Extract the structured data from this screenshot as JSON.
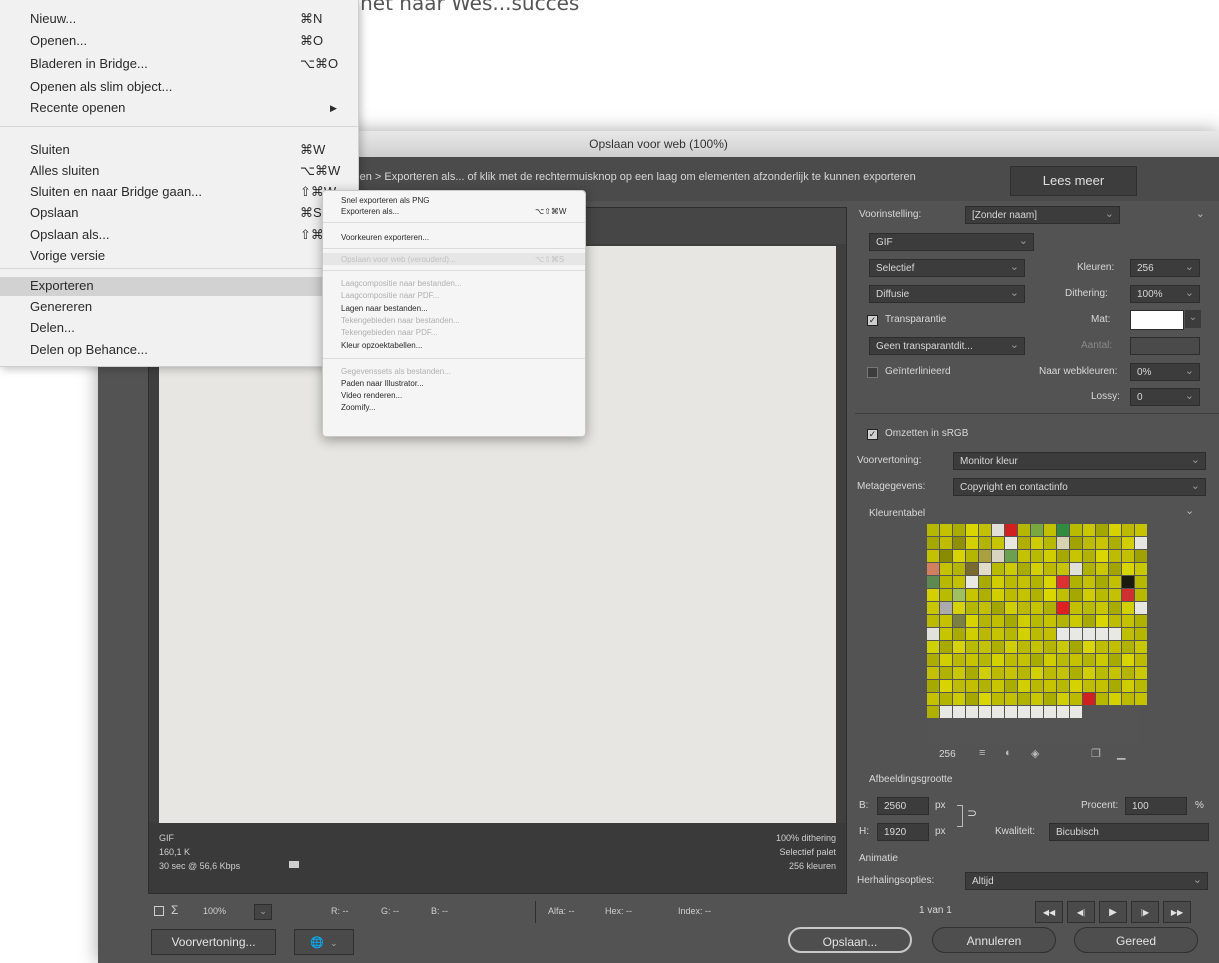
{
  "caption": "c) Sla je project open op en deel het naar Wes...succes",
  "dialog": {
    "title": "Opslaan voor web (100%)",
    "info_text": "tieen > Exporteren als... of klik met de rechtermuisknop op een laag om elementen afzonderlijk te kunnen exporteren",
    "lees_meer": "Lees meer"
  },
  "preview": {
    "format": "GIF",
    "size": "160,1 K",
    "time": "30 sec @ 56,6 Kbps",
    "dither": "100% dithering",
    "palette": "Selectief palet",
    "colors": "256 kleuren",
    "zoom": "100%",
    "r": "R: --",
    "g": "G: --",
    "b": "B: --",
    "alpha": "Alfa: --",
    "hex": "Hex: --",
    "index": "Index: --"
  },
  "panel": {
    "preset_label": "Voorinstelling:",
    "preset_value": "[Zonder naam]",
    "format_value": "GIF",
    "palette_value": "Selectief",
    "colors_label": "Kleuren:",
    "colors_value": "256",
    "dither_value": "Diffusie",
    "dither_label": "Dithering:",
    "dither_pct": "100%",
    "transparency_label": "Transparantie",
    "matte_label": "Mat:",
    "trans_dither_value": "Geen transparantdit...",
    "amount_label": "Aantal:",
    "interlaced_label": "Geïnterlinieerd",
    "web_snap_label": "Naar webkleuren:",
    "web_snap_value": "0%",
    "lossy_label": "Lossy:",
    "lossy_value": "0",
    "convert_srgb_label": "Omzetten in sRGB",
    "preview_label": "Voorvertoning:",
    "preview_value": "Monitor kleur",
    "metadata_label": "Metagegevens:",
    "metadata_value": "Copyright en contactinfo",
    "color_table_label": "Kleurentabel",
    "color_count": "256",
    "image_size_label": "Afbeeldingsgrootte",
    "w_label": "B:",
    "w_value": "2560",
    "h_label": "H:",
    "h_value": "1920",
    "px_label": "px",
    "percent_label": "Procent:",
    "percent_value": "100",
    "pct_sign": "%",
    "quality_label": "Kwaliteit:",
    "quality_value": "Bicubisch",
    "animation_label": "Animatie",
    "loop_label": "Herhalingsopties:",
    "loop_value": "Altijd",
    "frame_counter": "1 van 1",
    "swatches": [
      "#b5b800",
      "#c4c100",
      "#a9ad00",
      "#d9d500",
      "#c2c000",
      "#e0e0d8",
      "#d02020",
      "#b6b800",
      "#7aa840",
      "#c3c000",
      "#328c40",
      "#b8bb00",
      "#c9c700",
      "#a4a700",
      "#d5d200",
      "#bbb900",
      "#c6c400",
      "#a5a800",
      "#c0bd00",
      "#8e9000",
      "#d4d000",
      "#b2b400",
      "#c7c500",
      "#e8e8e0",
      "#b0ae00",
      "#cfcc00",
      "#b7b900",
      "#d7d3b0",
      "#a0a300",
      "#bdbb00",
      "#c8c500",
      "#acae00",
      "#d1ce00",
      "#e6e6e0",
      "#c4c100",
      "#8a8c00",
      "#d6d300",
      "#b4b600",
      "#a9a040",
      "#d8d4c0",
      "#6aa050",
      "#c4c200",
      "#b9bb00",
      "#d0cd00",
      "#a6a900",
      "#c7c500",
      "#b1b300",
      "#d9d600",
      "#bebc00",
      "#c2c000",
      "#9fa200",
      "#d08060",
      "#c5c300",
      "#b3b500",
      "#7b6a30",
      "#e0dcc8",
      "#b8ba00",
      "#cccb00",
      "#a8ab00",
      "#d3d000",
      "#bcba00",
      "#c6c400",
      "#e0e0d8",
      "#b0b200",
      "#c9c700",
      "#a2a500",
      "#d7d400",
      "#c8c800",
      "#5c8a50",
      "#b7b900",
      "#c3c100",
      "#e9e9e4",
      "#a9ac00",
      "#d0cd00",
      "#babb00",
      "#c4c200",
      "#b2b400",
      "#d8d500",
      "#dd3030",
      "#b0b200",
      "#c4c200",
      "#a7aa00",
      "#c2c000",
      "#1a1a10",
      "#b6b800",
      "#d4d000",
      "#b9bb00",
      "#a0c060",
      "#c7c500",
      "#aeb000",
      "#d2cf00",
      "#bdbb00",
      "#c5c300",
      "#b1b300",
      "#d9d600",
      "#c0be00",
      "#a5a800",
      "#cfcc00",
      "#b8ba00",
      "#c3c100",
      "#d03030",
      "#b7b900",
      "#c8c600",
      "#ababab",
      "#d5d200",
      "#b4b600",
      "#c1bf00",
      "#a3a600",
      "#d0cd00",
      "#bcba00",
      "#c6c400",
      "#afb100",
      "#e02020",
      "#c2c000",
      "#b9bb00",
      "#c9c700",
      "#a8ab00",
      "#d3d000",
      "#e8e8e0",
      "#bbb900",
      "#c4c200",
      "#7a8040",
      "#d6d300",
      "#b3b500",
      "#c0be00",
      "#a6a900",
      "#cfcc00",
      "#b8ba00",
      "#c5c300",
      "#b2b400",
      "#cbc900",
      "#a7aa00",
      "#d8d500",
      "#bebc00",
      "#c3c100",
      "#b0b200",
      "#e2e2dc",
      "#c7c500",
      "#a9ac00",
      "#d1ce00",
      "#bab800",
      "#c6c400",
      "#b5b700",
      "#d4d100",
      "#bdbb00",
      "#c2c000",
      "#e8e8e4",
      "#e8e8e4",
      "#e8e8e4",
      "#e8e8e4",
      "#e8e8e4",
      "#c0be00",
      "#b4b600",
      "#ced000",
      "#a8aa00",
      "#d5d200",
      "#b9bb00",
      "#c4c200",
      "#aeb000",
      "#d0cd00",
      "#bcba00",
      "#c5c300",
      "#b3b500",
      "#cac800",
      "#a5a800",
      "#d7d400",
      "#bfbd00",
      "#c1bf00",
      "#b0b200",
      "#c8c600",
      "#abae00",
      "#d2cf00",
      "#bab800",
      "#c6c400",
      "#b6b800",
      "#d4d100",
      "#bebc00",
      "#c3c100",
      "#a9ac00",
      "#cfcc00",
      "#b8ba00",
      "#c5c300",
      "#b2b400",
      "#cbc900",
      "#a7aa00",
      "#d8d500",
      "#bdbb00",
      "#c2c000",
      "#b0b200",
      "#c9c700",
      "#a9ac00",
      "#d1ce00",
      "#bbb900",
      "#c6c400",
      "#b5b700",
      "#d3d000",
      "#bcba00",
      "#c4c200",
      "#aeb000",
      "#d0cd00",
      "#b9bb00",
      "#c5c300",
      "#b3b500",
      "#cac800",
      "#a6a900",
      "#d7d400",
      "#bebc00",
      "#c1bf00",
      "#b1b300",
      "#c8c600",
      "#aaad00",
      "#d2cf00",
      "#bab800",
      "#c6c400",
      "#b7b900",
      "#d5d200",
      "#bfbd00",
      "#c3c100",
      "#a8ab00",
      "#cfcc00",
      "#b8ba00",
      "#c4c200",
      "#b2b400",
      "#cbc900",
      "#a5a800",
      "#d8d500",
      "#bdbb00",
      "#c2c000",
      "#b0b200",
      "#c9c700",
      "#aaad00",
      "#d1ce00",
      "#bbb900",
      "#d02020",
      "#b6b800",
      "#d4d100",
      "#bcba00",
      "#c5c300",
      "#afb100",
      "#e8e8e4",
      "#e8e8e4",
      "#e8e8e4",
      "#e8e8e4",
      "#e8e8e4",
      "#e8e8e4",
      "#e8e8e4",
      "#e8e8e4",
      "#e8e8e4",
      "#e8e8e4",
      "#e8e8e4"
    ]
  },
  "buttons": {
    "voorvertoning": "Voorvertoning...",
    "opslaan": "Opslaan...",
    "annuleren": "Annuleren",
    "gereed": "Gereed"
  },
  "filemenu": {
    "items": [
      {
        "label": "Nieuw...",
        "shortcut": "⌘N",
        "disabled": false
      },
      {
        "label": "Openen...",
        "shortcut": "⌘O",
        "disabled": false
      },
      {
        "label": "Bladeren in Bridge...",
        "shortcut": "⌥⌘O",
        "disabled": false
      },
      {
        "label": "Openen als slim object...",
        "shortcut": "",
        "disabled": false
      },
      {
        "label": "Recente openen",
        "shortcut": "▶",
        "disabled": false
      },
      {
        "label": "Sluiten",
        "shortcut": "⌘W",
        "disabled": false
      },
      {
        "label": "Alles sluiten",
        "shortcut": "⌥⌘W",
        "disabled": false
      },
      {
        "label": "Sluiten en naar Bridge gaan...",
        "shortcut": "⇧⌘W",
        "disabled": false
      },
      {
        "label": "Opslaan",
        "shortcut": "⌘S",
        "disabled": false
      },
      {
        "label": "Opslaan als...",
        "shortcut": "⇧⌘S",
        "disabled": false
      },
      {
        "label": "Vorige versie",
        "shortcut": "",
        "disabled": false
      },
      {
        "label": "Exporteren",
        "shortcut": "",
        "disabled": false
      },
      {
        "label": "Genereren",
        "shortcut": "",
        "disabled": false
      },
      {
        "label": "Delen...",
        "shortcut": "",
        "disabled": false
      },
      {
        "label": "Delen op Behance...",
        "shortcut": "",
        "disabled": false
      }
    ]
  },
  "submenu": {
    "items": [
      {
        "label": "Snel exporteren als PNG",
        "shortcut": "",
        "disabled": false
      },
      {
        "label": "Exporteren als...",
        "shortcut": "⌥⇧⌘W",
        "disabled": false
      },
      {
        "label": "Voorkeuren exporteren...",
        "shortcut": "",
        "disabled": false
      },
      {
        "label": "Opslaan voor web (verouderd)...",
        "shortcut": "⌥⇧⌘S",
        "disabled": false
      },
      {
        "label": "Laagcompositie naar bestanden...",
        "shortcut": "",
        "disabled": true
      },
      {
        "label": "Laagcompositie naar PDF...",
        "shortcut": "",
        "disabled": true
      },
      {
        "label": "Lagen naar bestanden...",
        "shortcut": "",
        "disabled": false
      },
      {
        "label": "Tekengebieden naar bestanden...",
        "shortcut": "",
        "disabled": true
      },
      {
        "label": "Tekengebieden naar PDF...",
        "shortcut": "",
        "disabled": true
      },
      {
        "label": "Kleur opzoektabellen...",
        "shortcut": "",
        "disabled": false
      },
      {
        "label": "Gegevenssets als bestanden...",
        "shortcut": "",
        "disabled": true
      },
      {
        "label": "Paden naar Illustrator...",
        "shortcut": "",
        "disabled": false
      },
      {
        "label": "Video renderen...",
        "shortcut": "",
        "disabled": false
      },
      {
        "label": "Zoomify...",
        "shortcut": "",
        "disabled": false
      }
    ]
  }
}
